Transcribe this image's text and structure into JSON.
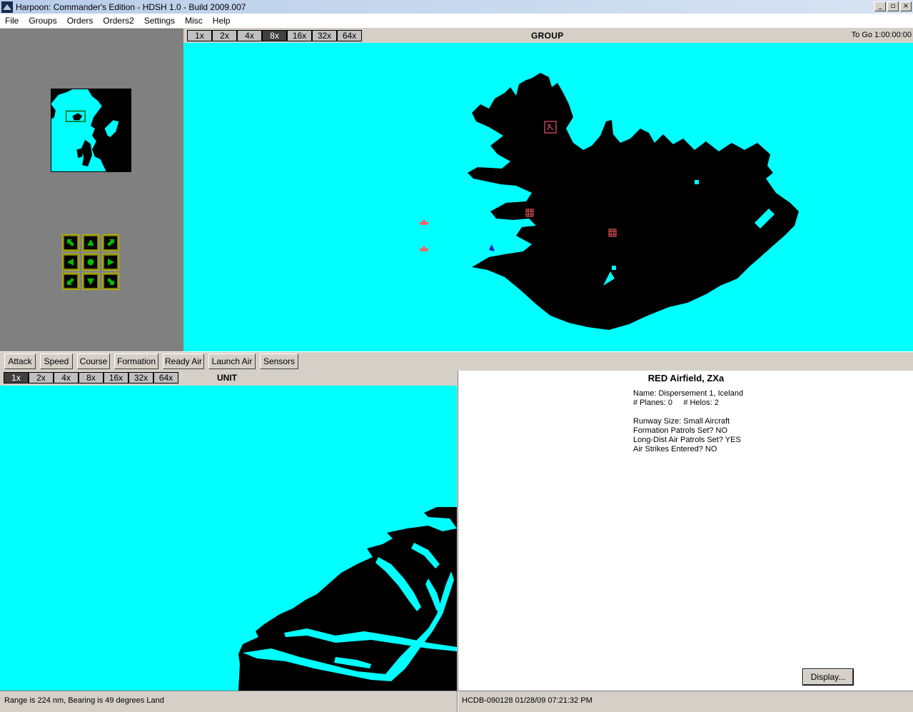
{
  "window": {
    "title": "Harpoon: Commander's Edition - HDSH 1.0 - Build 2009.007",
    "min_label": "_",
    "max_label": "▫",
    "close_label": "×"
  },
  "menu": [
    "File",
    "Groups",
    "Orders",
    "Orders2",
    "Settings",
    "Misc",
    "Help"
  ],
  "group": {
    "zoom": [
      "1x",
      "2x",
      "4x",
      "8x",
      "16x",
      "32x",
      "64x"
    ],
    "active_zoom": "8x",
    "title": "GROUP",
    "togo": "To Go 1:00:00:00"
  },
  "commands": [
    "Attack",
    "Speed",
    "Course",
    "Formation",
    "Ready Air",
    "Launch Air",
    "Sensors"
  ],
  "unit": {
    "zoom": [
      "1x",
      "2x",
      "4x",
      "8x",
      "16x",
      "32x",
      "64x"
    ],
    "active_zoom": "1x",
    "title": "UNIT"
  },
  "info": {
    "title": "RED Airfield, ZXa",
    "name": "Name: Dispersement 1, Iceland",
    "planes": "# Planes: 0     # Helos: 2",
    "runway": "Runway Size: Small Aircraft",
    "formation": "Formation Patrols Set? NO",
    "longdist": "Long-Dist Air Patrols Set? YES",
    "strikes": "Air Strikes Entered? NO",
    "display_button": "Display..."
  },
  "status": {
    "left": "Range is 224 nm, Bearing is 49 degrees Land",
    "right": "HCDB-090128 01/28/09 07:21:32 PM"
  },
  "colors": {
    "sea": "#00ffff",
    "land": "#000000",
    "airfield": "#ff6060",
    "ship": "#ff6060",
    "pad_arrow": "#00c000"
  }
}
